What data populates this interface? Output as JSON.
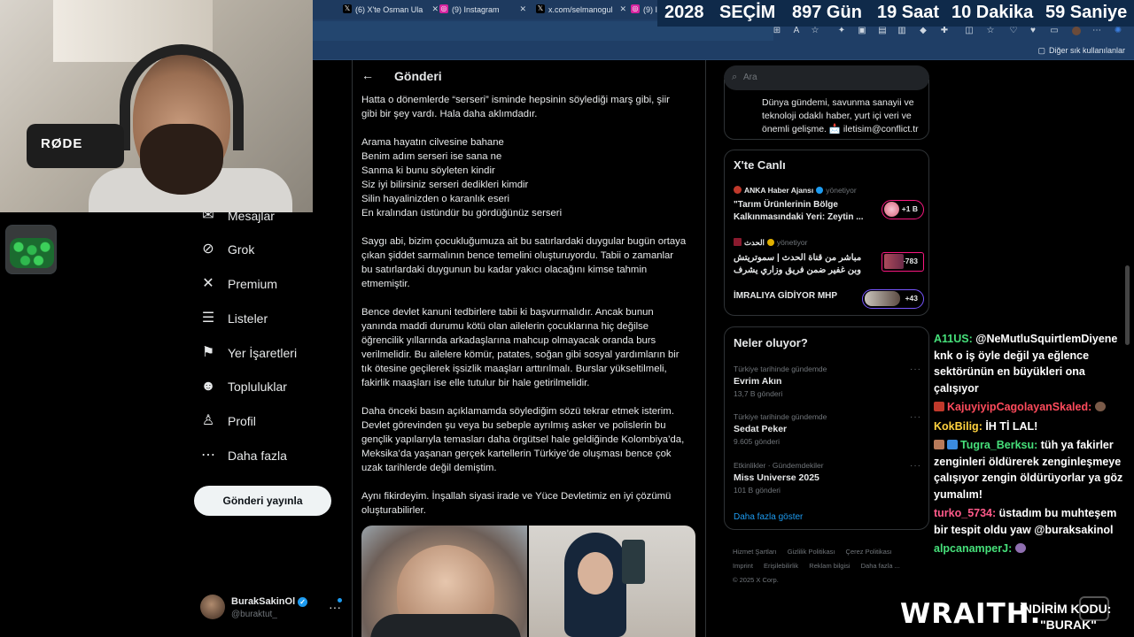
{
  "browser": {
    "tabs": [
      {
        "label": "(6) X'te Osman Ula",
        "icon": "x-icon",
        "close": "✕"
      },
      {
        "label": "(9) Instagram",
        "icon": "instagram-icon",
        "close": "✕"
      },
      {
        "label": "x.com/selmanogul",
        "icon": "x-icon",
        "close": "✕"
      },
      {
        "label": "(9) Ins",
        "icon": "instagram-icon",
        "close": ""
      }
    ],
    "bookmarks_other": "Diğer sık kullanılanlar"
  },
  "countdown": {
    "year": "2028",
    "label": "SEÇİM",
    "days": "897 Gün",
    "hours": "19 Saat",
    "minutes": "10 Dakika",
    "seconds": "59 Saniye"
  },
  "webcam": {
    "mic_brand": "RØDE"
  },
  "nav": {
    "items": [
      {
        "label": "Mesajlar",
        "icon": "mail-icon"
      },
      {
        "label": "Grok",
        "icon": "grok-icon"
      },
      {
        "label": "Premium",
        "icon": "x-premium-icon"
      },
      {
        "label": "Listeler",
        "icon": "list-icon"
      },
      {
        "label": "Yer İşaretleri",
        "icon": "bookmark-icon"
      },
      {
        "label": "Topluluklar",
        "icon": "communities-icon"
      },
      {
        "label": "Profil",
        "icon": "profile-icon"
      },
      {
        "label": "Daha fazla",
        "icon": "more-circle-icon"
      }
    ],
    "post_button": "Gönderi yayınla"
  },
  "account": {
    "name": "BurakSakinOl",
    "handle": "@buraktut_",
    "more": "···"
  },
  "post": {
    "header": "Gönderi",
    "paragraphs": [
      [
        "Hatta o dönemlerde “serseri” isminde hepsinin söylediği marş gibi, şiir",
        "gibi bir şey vardı. Hala daha aklımdadır."
      ],
      [
        "Arama hayatın cilvesine bahane",
        "Benim adım serseri ise sana ne",
        "Sanma ki bunu söyleten kindir",
        "Siz iyi bilirsiniz serseri dedikleri kimdir",
        "Silin hayalinizden o karanlık eseri",
        "En kralından üstündür bu gördüğünüz serseri"
      ],
      [
        "Saygı abi, bizim çocukluğumuza ait bu satırlardaki duygular bugün ortaya",
        "çıkan şiddet sarmalının bence temelini oluşturuyordu. Tabii o zamanlar",
        "bu satırlardaki duygunun bu kadar yakıcı olacağını kimse tahmin",
        "etmemiştir."
      ],
      [
        "Bence devlet kanuni tedbirlere tabii ki başvurmalıdır. Ancak bunun",
        "yanında maddi durumu kötü olan ailelerin çocuklarına hiç değilse",
        "öğrencilik yıllarında arkadaşlarına mahcup olmayacak oranda burs",
        "verilmelidir. Bu ailelere kömür, patates, soğan gibi sosyal yardımların bir",
        "tık ötesine geçilerek işsizlik maaşları arttırılmalı. Burslar yükseltilmeli,",
        "fakirlik maaşları ise elle tutulur bir hale getirilmelidir."
      ],
      [
        "Daha önceki basın açıklamamda söylediğim sözü tekrar etmek isterim.",
        "Devlet görevinden şu veya bu sebeple ayrılmış asker ve polislerin bu",
        "gençlik yapılarıyla temasları daha örgütsel hale geldiğinde Kolombiya’da,",
        "Meksika’da yaşanan gerçek kartellerin Türkiye’de oluşması bence çok",
        "uzak tarihlerde değil demiştim."
      ],
      [
        "Aynı fikirdeyim. İnşallah siyasi irade ve Yüce Devletimiz en iyi çözümü",
        "oluşturabilirler."
      ]
    ]
  },
  "sidebar": {
    "search_placeholder": "Ara",
    "about_text": "Dünya gündemi, savunma sanayii ve teknoloji odaklı haber, yurt içi veri ve önemli gelişme. 📩 iletisim@conflict.tr",
    "live": {
      "title": "X'te Canlı",
      "items": [
        {
          "source": "ANKA Haber Ajansı",
          "status": "yönetiyor",
          "title": "\"Tarım Ürünlerinin Bölge Kalkınmasındaki Yeri: Zeytin ...",
          "count": "+1 B"
        },
        {
          "source": "الحدث",
          "status": "yönetiyor",
          "title": "مباشر من قناة الحدث | سموتريتش وبن غفير ضمن فريق وزاري يشرف ...",
          "count": "+783"
        },
        {
          "source": "",
          "status": "",
          "title": "İMRALIYA GİDİYOR MHP",
          "count": "+43"
        }
      ]
    },
    "trends": {
      "title": "Neler oluyor?",
      "items": [
        {
          "context": "Türkiye tarihinde gündemde",
          "name": "Evrim Akın",
          "count": "13,7 B gönderi"
        },
        {
          "context": "Türkiye tarihinde gündemde",
          "name": "Sedat Peker",
          "count": "9.605 gönderi"
        },
        {
          "context": "Etkinlikler · Gündemdekiler",
          "name": "Miss Universe 2025",
          "count": "101 B gönderi"
        }
      ],
      "more_dots": "···",
      "show_more": "Daha fazla göster"
    },
    "footer": [
      "Hizmet Şartları",
      "Gizlilik Politikası",
      "Çerez Politikası",
      "Imprint",
      "Erişilebilirlik",
      "Reklam bilgisi",
      "Daha fazla ...",
      "© 2025 X Corp."
    ]
  },
  "chat": [
    {
      "user": "A11US:",
      "color": "#46e07a",
      "text": " @NeMutluSquirtlemDiyene knk o iş öyle değil ya eğlence sektörünün en büyükleri ona çalışıyor"
    },
    {
      "user": "KajuyiyipCagolayanSkaled:",
      "color": "#ff4b5c",
      "text": ""
    },
    {
      "user": "KokBilig:",
      "color": "#ffd23f",
      "text": " İH Tİ LAL!"
    },
    {
      "user": "Tugra_Berksu:",
      "color": "#46e07a",
      "text": " tüh ya fakirler zenginleri öldürerek zenginleşmeye çalışıyor zengin öldürüyorlar ya göz yumalım!"
    },
    {
      "user": "turko_5734:",
      "color": "#ff5a8a",
      "text": " üstadım bu muhteşem bir tespit oldu yaw @buraksakinol"
    },
    {
      "user": "alpcanamperJ:",
      "color": "#46e07a",
      "text": ""
    }
  ],
  "ad": {
    "brand": "WRAITH.",
    "line1": "İNDİRİM KODU:",
    "line2": "\"BURAK\""
  }
}
